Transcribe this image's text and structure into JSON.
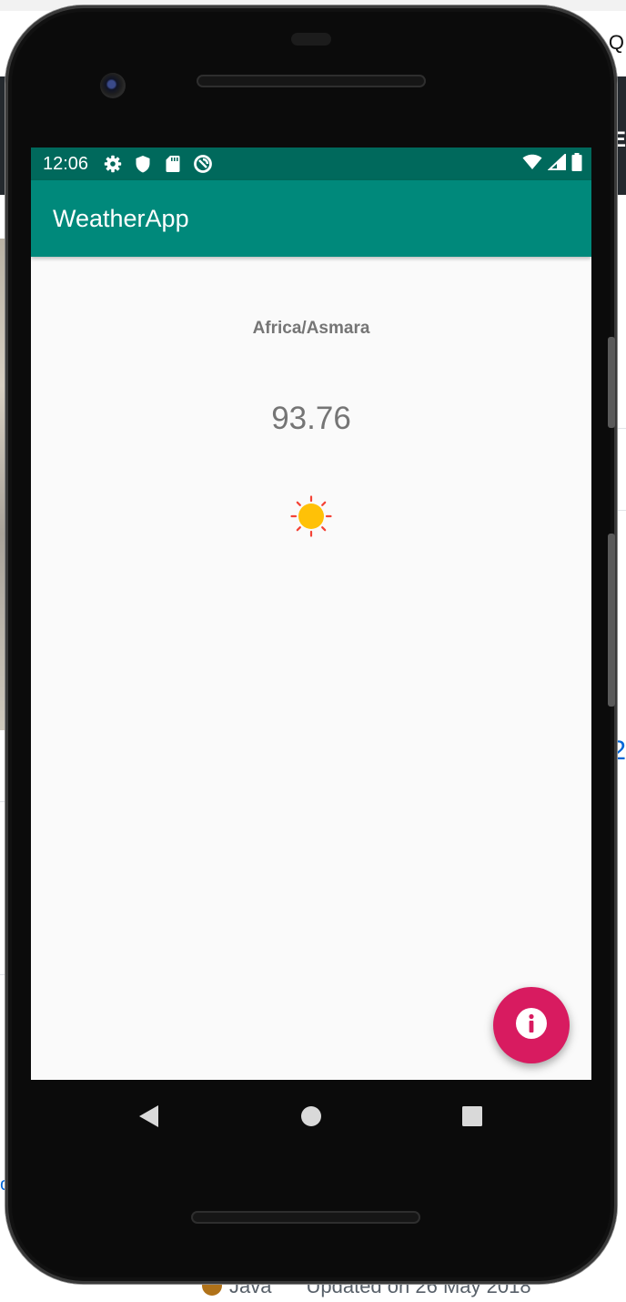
{
  "background_page": {
    "partial_right_letter_top": "Q",
    "partial_right_letter_bar": "E",
    "partial_right_digit": "2",
    "partial_left_letter": "o",
    "footer_language": "Java",
    "footer_updated": "Updated on 26 May 2018",
    "language_color": "#b07219"
  },
  "device": {
    "status_bar": {
      "time": "12:06",
      "left_icons": [
        "settings-icon",
        "shield-icon",
        "sd-card-icon",
        "sync-icon"
      ],
      "right_icons": [
        "wifi-icon",
        "cell-signal-icon",
        "battery-icon"
      ],
      "color": "#00695c"
    },
    "app_bar": {
      "title": "WeatherApp",
      "color": "#00897b"
    },
    "content": {
      "location": "Africa/Asmara",
      "temperature": "93.76",
      "condition_icon": "sun-icon"
    },
    "fab": {
      "icon": "info-icon",
      "color": "#d81b60"
    },
    "nav_bar": [
      "back-icon",
      "home-icon",
      "recents-icon"
    ]
  }
}
